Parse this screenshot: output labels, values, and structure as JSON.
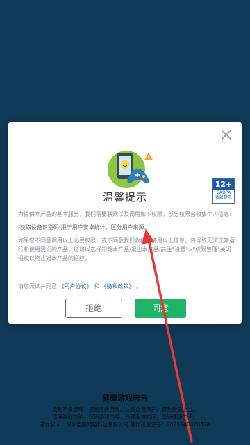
{
  "dialog": {
    "title": "温馨提示",
    "age_rating": {
      "top": "12+",
      "mid": "CADPA",
      "bottom": "适龄提示"
    },
    "paragraphs": [
      "为提供本产品的基本服务，我们需要联网以及调用如下权限，部分权限会收集个人信息:",
      "-获取设备识别码:用于用户安卓统计、区分用户来源。",
      "如果您不同意调用以上必要权限，或不同意我们收集并使用以上信息，将导致无法正常运行和使用我们的产品，您可以选择卸载本产品/退出本产品/前往\"设置\">\"权限管理\"关闭授权以终止对本产品的授权。"
    ],
    "agree_prefix": "请您阅读并同意",
    "user_agreement": "《用户协议》",
    "and": "和",
    "privacy_policy": "《隐私政策》",
    "period": "。",
    "refuse_label": "拒绝",
    "agree_label": "同意"
  },
  "footer": {
    "title": "健康游戏忠告",
    "lines": [
      "抵制不良游戏，拒绝盗版游戏，注意自我保护，谨防受骗上当。",
      "适度游戏益脑，沉迷游戏伤身，合理安排时间，享受健康生活。",
      "著作权人：深圳佳朋网络科技有限公司    著作权登记号：2025SA0020528"
    ]
  },
  "colors": {
    "background": "#0f3a57",
    "agree_button": "#20b46a",
    "link": "#2f6fb3",
    "annotation_arrow": "#e53935"
  },
  "icons": [
    "close-icon",
    "phone-controller-icon",
    "age-rating-badge-icon",
    "annotation-arrow"
  ]
}
